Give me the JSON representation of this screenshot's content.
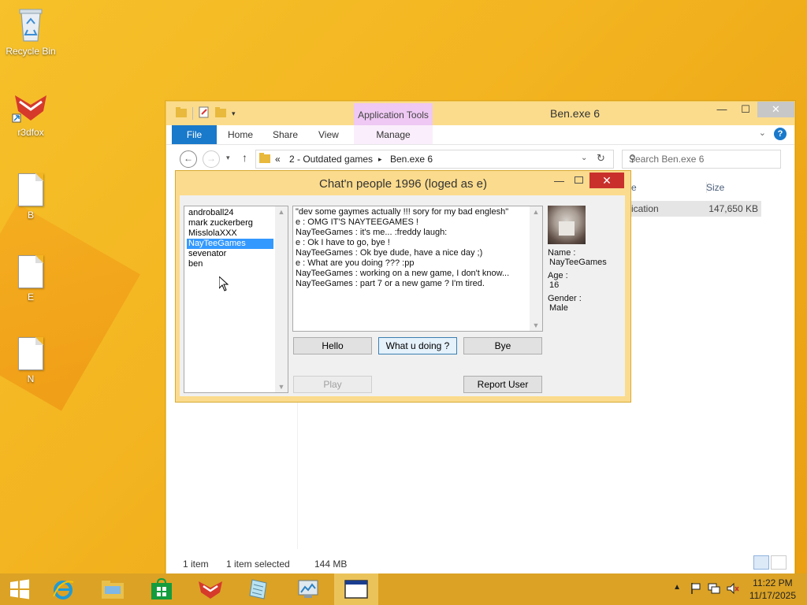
{
  "desktop": {
    "icons": [
      {
        "label": "Recycle Bin",
        "icon": "recycle-bin-icon"
      },
      {
        "label": "r3dfox",
        "icon": "r3dfox-icon"
      },
      {
        "label": "B",
        "icon": "file-icon"
      },
      {
        "label": "E",
        "icon": "file-icon"
      },
      {
        "label": "N",
        "icon": "file-icon"
      }
    ]
  },
  "explorer": {
    "title": "Ben.exe 6",
    "contextual_tab": "Application Tools",
    "tabs": {
      "file": "File",
      "home": "Home",
      "share": "Share",
      "view": "View",
      "manage": "Manage"
    },
    "address": {
      "overflow": "«",
      "crumb1": "2 - Outdated games",
      "sep": "▸",
      "crumb2": "Ben.exe 6"
    },
    "search": {
      "placeholder": "Search Ben.exe 6"
    },
    "columns": {
      "type_partial": "e",
      "size": "Size"
    },
    "file_row": {
      "type_partial": "ication",
      "size": "147,650 KB"
    },
    "status": {
      "items": "1 item",
      "selected": "1 item selected",
      "size": "144 MB"
    },
    "accent": "#1979ca",
    "titlebar_color": "#fbdc8d"
  },
  "chat": {
    "title": "Chat'n people 1996 (loged as e)",
    "users": [
      "androball24",
      "mark zuckerberg",
      "MisslolaXXX",
      "NayTeeGames",
      "sevenator",
      "ben"
    ],
    "selected_user": "NayTeeGames",
    "messages": [
      "\"dev some gaymes actually !!! sory for my bad englesh\"",
      "e : OMG IT'S NAYTEEGAMES !",
      "NayTeeGames : it's me... :freddy laugh:",
      "e : Ok I have to go, bye !",
      "NayTeeGames : Ok bye dude, have a nice day ;)",
      "e : What are you doing ??? :pp",
      "NayTeeGames : working on a new game, I don't know...",
      "NayTeeGames :  part 7 or a new game ? I'm tired."
    ],
    "buttons": {
      "hello": "Hello",
      "what": "What u doing ?",
      "bye": "Bye",
      "play": "Play",
      "report": "Report User"
    },
    "profile": {
      "name_label": "Name :",
      "name_value": "NayTeeGames",
      "age_label": "Age :",
      "age_value": "16",
      "gender_label": "Gender :",
      "gender_value": "Male"
    },
    "close_color": "#c9302c"
  },
  "taskbar": {
    "apps": [
      "start-icon",
      "internet-explorer-icon",
      "file-explorer-icon",
      "store-icon",
      "r3dfox-icon",
      "notepad-icon",
      "control-panel-icon",
      "app-window-icon"
    ],
    "time": "11:22 PM",
    "date": "11/17/2025"
  }
}
